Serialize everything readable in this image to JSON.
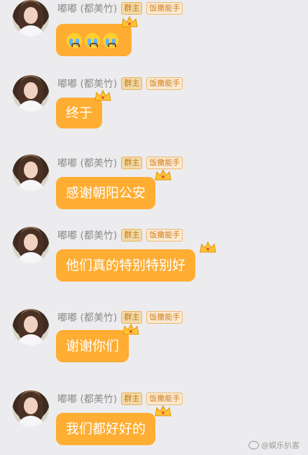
{
  "sender": {
    "name": "嘟嘟 (都美竹)",
    "badge_owner": "群主",
    "badge_title": "饭撒能手"
  },
  "messages": [
    {
      "text": "",
      "emoji_count": 3,
      "emoji": "loudly-crying-face-icon"
    },
    {
      "text": "终于"
    },
    {
      "text": "感谢朝阳公安"
    },
    {
      "text": "他们真的特别特别好"
    },
    {
      "text": "谢谢你们"
    },
    {
      "text": "我们都好好的"
    }
  ],
  "watermark": "@娱乐扒客",
  "colors": {
    "bubble": "#ffad33",
    "background": "#ececee"
  }
}
